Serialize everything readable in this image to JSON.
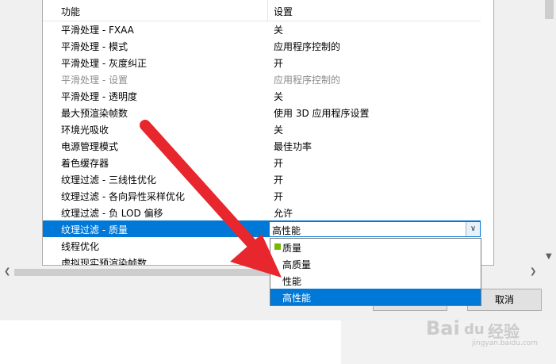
{
  "table": {
    "header": {
      "feature": "功能",
      "setting": "设置"
    },
    "rows": [
      {
        "feature": "平滑处理 - FXAA",
        "setting": "关",
        "disabled": false
      },
      {
        "feature": "平滑处理 - 模式",
        "setting": "应用程序控制的",
        "disabled": false
      },
      {
        "feature": "平滑处理 - 灰度纠正",
        "setting": "开",
        "disabled": false
      },
      {
        "feature": "平滑处理 - 设置",
        "setting": "应用程序控制的",
        "disabled": true
      },
      {
        "feature": "平滑处理 - 透明度",
        "setting": "关",
        "disabled": false
      },
      {
        "feature": "最大预渲染帧数",
        "setting": "使用 3D 应用程序设置",
        "disabled": false
      },
      {
        "feature": "环境光吸收",
        "setting": "关",
        "disabled": false
      },
      {
        "feature": "电源管理模式",
        "setting": "最佳功率",
        "disabled": false
      },
      {
        "feature": "着色缓存器",
        "setting": "开",
        "disabled": false
      },
      {
        "feature": "纹理过滤 - 三线性优化",
        "setting": "开",
        "disabled": false
      },
      {
        "feature": "纹理过滤 - 各向异性采样优化",
        "setting": "开",
        "disabled": false
      },
      {
        "feature": "纹理过滤 - 负 LOD 偏移",
        "setting": "允许",
        "disabled": false
      },
      {
        "feature": "纹理过滤 - 质量",
        "setting": "高性能",
        "selected": true
      },
      {
        "feature": "线程优化",
        "setting": ""
      },
      {
        "feature": "虚拟现实预渲染帧数",
        "setting": ""
      }
    ]
  },
  "combo": {
    "value": "高性能",
    "arrow": "chevron-down-icon"
  },
  "dropdown": {
    "options": [
      {
        "label": "质量",
        "badge": "nvidia-icon"
      },
      {
        "label": "高质量"
      },
      {
        "label": "性能"
      },
      {
        "label": "高性能",
        "highlighted": true
      }
    ]
  },
  "buttons": {
    "cancel": "取消",
    "ok": ""
  },
  "watermark": {
    "brand": "Bai",
    "paw": "du",
    "cn": "经验",
    "url": "jingyan.baidu.com"
  },
  "colors": {
    "selection": "#0078d7",
    "arrow": "#e8262d"
  }
}
